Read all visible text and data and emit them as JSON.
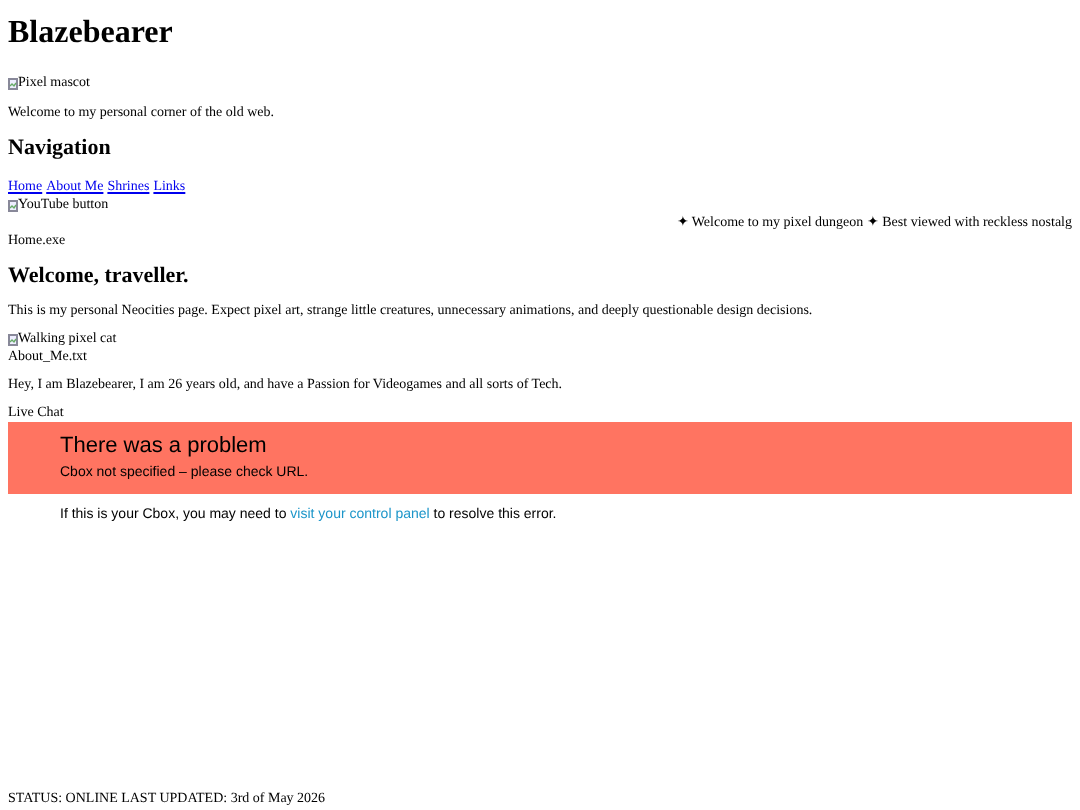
{
  "title": "Blazebearer",
  "mascot": {
    "alt": "Pixel mascot"
  },
  "intro": "Welcome to my personal corner of the old web.",
  "nav": {
    "heading": "Navigation",
    "links": [
      "Home",
      "About Me",
      "Shrines",
      "Links"
    ]
  },
  "youtube_button": {
    "alt": "YouTube button"
  },
  "marquee": "✦ Welcome to my pixel dungeon ✦ Best viewed with reckless nostalg",
  "home": {
    "window_label": "Home.exe",
    "heading": "Welcome, traveller.",
    "text": "This is my personal Neocities page. Expect pixel art, strange little creatures, unnecessary animations, and deeply questionable design decisions.",
    "cat": {
      "alt": "Walking pixel cat"
    }
  },
  "about": {
    "window_label": "About_Me.txt",
    "text": "Hey, I am Blazebearer, I am 26 years old, and have a Passion for Videogames and all sorts of Tech."
  },
  "chat": {
    "label": "Live Chat",
    "error_title": "There was a problem",
    "error_message": "Cbox not specified – please check URL.",
    "help_before": "If this is your Cbox, you may need to ",
    "help_link": "visit your control panel",
    "help_after": " to resolve this error."
  },
  "status_bar": "STATUS: ONLINE LAST UPDATED: 3rd of May 2026"
}
